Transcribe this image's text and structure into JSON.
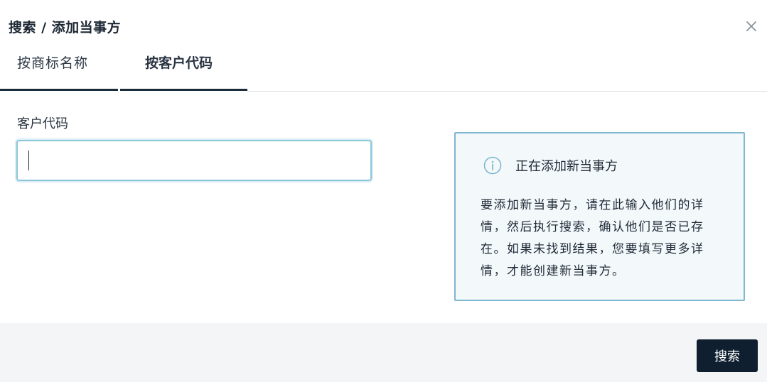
{
  "dialog": {
    "title": "搜索 / 添加当事方",
    "close_icon": "close-icon"
  },
  "tabs": [
    {
      "label": "按商标名称",
      "active": false
    },
    {
      "label": "按客户代码",
      "active": true
    }
  ],
  "form": {
    "customer_code_label": "客户代码",
    "customer_code_value": "",
    "customer_code_placeholder": ""
  },
  "info": {
    "icon": "info-icon",
    "title": "正在添加新当事方",
    "body": "要添加新当事方，请在此输入他们的详情，然后执行搜索，确认他们是否已存在。如果未找到结果，您要填写更多详情，才能创建新当事方。"
  },
  "footer": {
    "search_label": "搜索"
  },
  "colors": {
    "primary_button": "#0f1f2f",
    "info_border": "#7fb8cf",
    "info_background": "#f3f8fb",
    "input_focus_border": "#8ec5d9"
  }
}
